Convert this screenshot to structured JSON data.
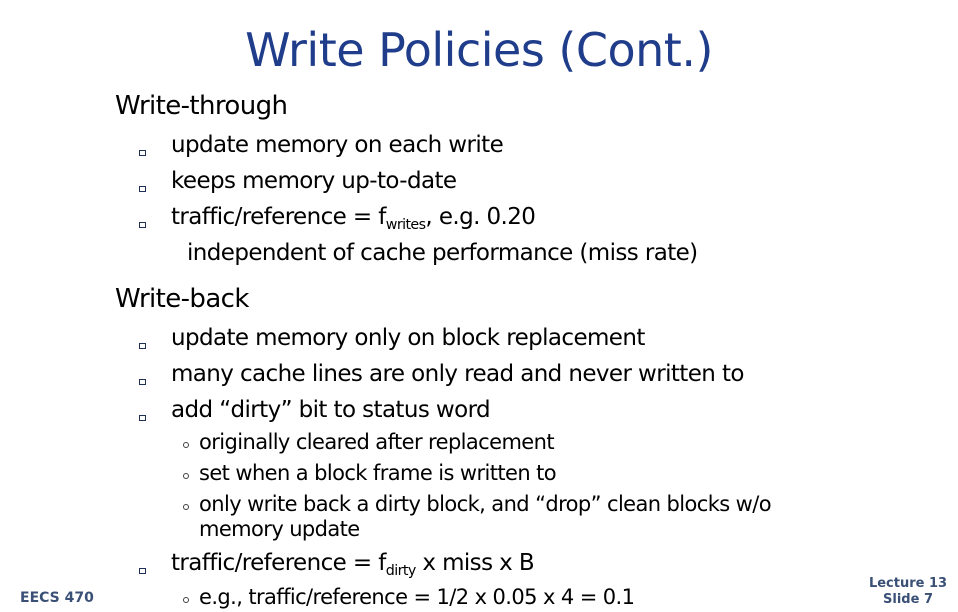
{
  "title": "Write Policies (Cont.)",
  "sections": [
    {
      "heading": "Write-through",
      "bullets": [
        {
          "text": "update memory on each write"
        },
        {
          "text": "keeps memory up-to-date"
        },
        {
          "pre": "traffic/reference = f",
          "sub": "writes",
          "post": ", e.g. 0.20",
          "continuation": "independent of cache performance (miss rate)"
        }
      ]
    },
    {
      "heading": "Write-back",
      "bullets": [
        {
          "text": "update memory only on block replacement"
        },
        {
          "text": "many cache lines are only read and never written to"
        },
        {
          "text": "add “dirty” bit to status word",
          "subbullets": [
            "originally cleared after replacement",
            "set when a block frame is written to",
            "only write back a dirty block, and  “drop” clean blocks w/o",
            "memory update"
          ]
        },
        {
          "pre": "traffic/reference = f",
          "sub": "dirty",
          "post": " x miss x B",
          "subbullets": [
            "e.g., traffic/reference = 1/2 x 0.05 x 4 = 0.1"
          ]
        }
      ]
    }
  ],
  "footer": {
    "course": "EECS  470",
    "lecture": "Lecture 13",
    "slide": "Slide 7"
  },
  "colors": {
    "title": "#1f3d8a",
    "footer": "#3a5076",
    "text": "#000000"
  }
}
